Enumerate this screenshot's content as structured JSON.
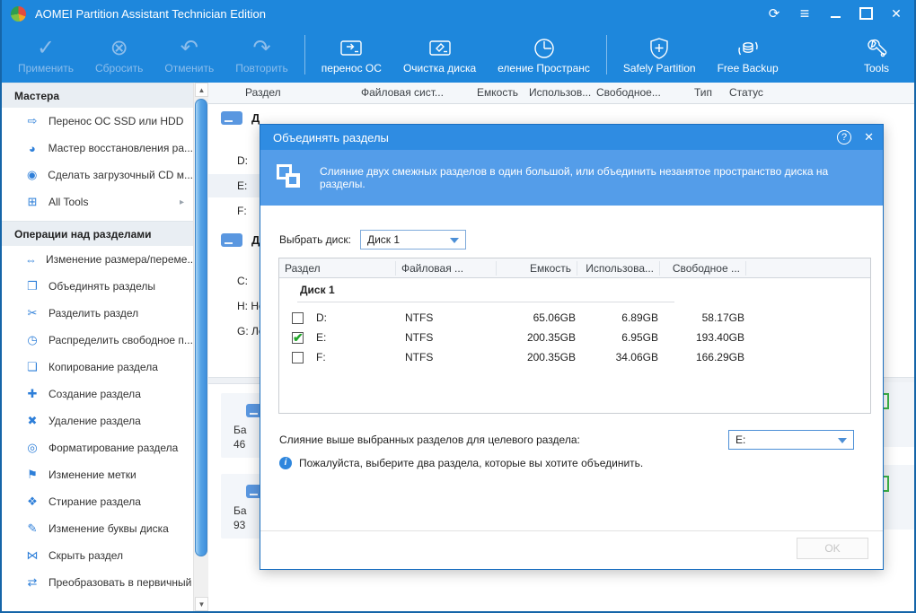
{
  "window": {
    "title": "AOMEI Partition Assistant Technician Edition"
  },
  "toolbar": {
    "disabled": [
      {
        "icon": "apply-check-icon",
        "label": "Применить"
      },
      {
        "icon": "discard-circle-x-icon",
        "label": "Сбросить"
      },
      {
        "icon": "undo-icon",
        "label": "Отменить"
      },
      {
        "icon": "redo-icon",
        "label": "Повторить"
      }
    ],
    "actions": [
      {
        "icon": "migrate-os-disk-icon",
        "label": "перенос ОС"
      },
      {
        "icon": "disk-cleanup-icon",
        "label": "Очистка диска"
      },
      {
        "icon": "space-allocation-clock-icon",
        "label": "еление Пространс"
      },
      {
        "icon": "shield-plus-icon",
        "label": "Safely Partition"
      },
      {
        "icon": "backup-database-icon",
        "label": "Free Backup"
      }
    ],
    "tools_label": "Tools"
  },
  "sidebar": {
    "sections": [
      {
        "title": "Мастера",
        "items": [
          {
            "label": "Перенос ОС SSD или HDD"
          },
          {
            "label": "Мастер восстановления ра..."
          },
          {
            "label": "Сделать загрузочный CD м..."
          },
          {
            "label": "All Tools"
          }
        ]
      },
      {
        "title": "Операции над разделами",
        "items": [
          {
            "label": "Изменение размера/переме..."
          },
          {
            "label": "Объединять разделы"
          },
          {
            "label": "Разделить раздел"
          },
          {
            "label": "Распределить свободное п..."
          },
          {
            "label": "Копирование раздела"
          },
          {
            "label": "Создание раздела"
          },
          {
            "label": "Удаление раздела"
          },
          {
            "label": "Форматирование раздела"
          },
          {
            "label": "Изменение метки"
          },
          {
            "label": "Стирание раздела"
          },
          {
            "label": "Изменение буквы диска"
          },
          {
            "label": "Скрыть раздел"
          },
          {
            "label": "Преобразовать в первичный"
          }
        ]
      }
    ]
  },
  "main_table": {
    "columns": [
      "Раздел",
      "Файловая сист...",
      "Емкость",
      "Использов...",
      "Свободное...",
      "Тип",
      "Статус"
    ]
  },
  "disk_list": {
    "groups": [
      {
        "name": "Д",
        "partitions": [
          "D:",
          "E:",
          "F:"
        ]
      },
      {
        "name": "Д",
        "partitions": [
          "C:",
          "H: Нов",
          "G: Лок"
        ]
      }
    ]
  },
  "disk_map": {
    "blocks": [
      {
        "line1": "Ба",
        "line2": "46"
      },
      {
        "line1": "Ба",
        "line2": "93"
      }
    ]
  },
  "dialog": {
    "title": "Объединять разделы",
    "description": "Слияние двух смежных разделов в один большой, или объединить незанятое пространство диска на разделы.",
    "select_disk_label": "Выбрать диск:",
    "disk_value": "Диск 1",
    "table": {
      "columns": [
        "Раздел",
        "Файловая ...",
        "Емкость",
        "Использова...",
        "Свободное ..."
      ],
      "group": "Диск 1",
      "rows": [
        {
          "check": "",
          "partition": "D:",
          "fs": "NTFS",
          "capacity": "65.06GB",
          "used": "6.89GB",
          "free": "58.17GB"
        },
        {
          "check": "✔",
          "partition": "E:",
          "fs": "NTFS",
          "capacity": "200.35GB",
          "used": "6.95GB",
          "free": "193.40GB"
        },
        {
          "check": "",
          "partition": "F:",
          "fs": "NTFS",
          "capacity": "200.35GB",
          "used": "34.06GB",
          "free": "166.29GB"
        }
      ]
    },
    "target_label": "Слияние выше выбранных разделов для целевого раздела:",
    "target_value": "E:",
    "info": "Пожалуйста, выберите два раздела, которые вы хотите объединить.",
    "ok_label": "OK"
  }
}
